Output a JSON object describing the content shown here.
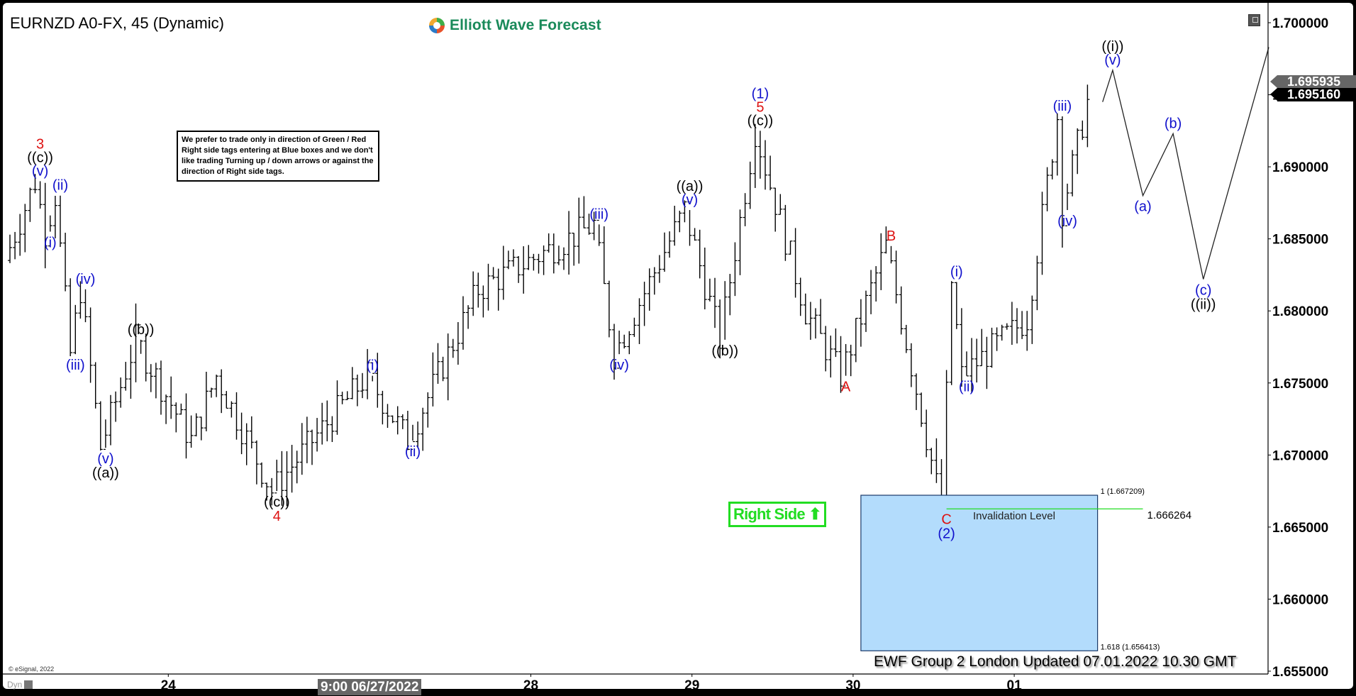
{
  "header": {
    "title": "EURNZD A0-FX, 45 (Dynamic)",
    "logo_text": "Elliott Wave Forecast",
    "notice": "We prefer to trade only in direction of Green / Red Right side tags entering at Blue boxes and we don't like trading Turning up / down arrows or against the direction of Right side tags."
  },
  "footer": {
    "copyright": "© eSignal, 2022",
    "dyn_label": "Dyn",
    "cursor_timestamp": "9:00 06/27/2022",
    "updated_text": "EWF Group 2 London Updated 07.01.2022 10.30 GMT"
  },
  "tags": {
    "right_side": "Right Side",
    "right_side_arrow": "up"
  },
  "price_tags": {
    "gray": "1.695935",
    "black": "1.695160"
  },
  "colors": {
    "bars": "#000000",
    "blue_labels": "#1010cc",
    "red_labels": "#dd1111",
    "black_labels": "#000000",
    "blue_box": "#b3dcfc",
    "invalidation_line": "#22dd22",
    "right_side": "#22dd22"
  },
  "chart_data": {
    "type": "ohlc",
    "symbol": "EURNZD A0-FX",
    "interval": "45 (Dynamic)",
    "ylim": [
      1.655,
      1.7
    ],
    "yticks": [
      "1.700000",
      "1.695000",
      "1.690000",
      "1.685000",
      "1.680000",
      "1.675000",
      "1.670000",
      "1.665000",
      "1.660000",
      "1.655000"
    ],
    "yticks_values": [
      1.7,
      1.695,
      1.69,
      1.685,
      1.68,
      1.675,
      1.67,
      1.665,
      1.66,
      1.655
    ],
    "xticks": [
      {
        "label": "24",
        "bar": 23
      },
      {
        "label": "28",
        "bar": 95
      },
      {
        "label": "29",
        "bar": 127
      },
      {
        "label": "30",
        "bar": 159
      },
      {
        "label": "01",
        "bar": 191
      }
    ],
    "last_price": 1.69516,
    "prev_close_tag": 1.695935,
    "path_anchors": [
      {
        "bar": 0,
        "price": 1.6835
      },
      {
        "bar": 6,
        "price": 1.689,
        "label": [
          "(v)",
          "((c))",
          "3"
        ]
      },
      {
        "bar": 8,
        "price": 1.6855,
        "label": [
          "(i)"
        ]
      },
      {
        "bar": 10,
        "price": 1.688,
        "label": [
          "(ii)"
        ]
      },
      {
        "bar": 13,
        "price": 1.677,
        "label": [
          "(iii)"
        ]
      },
      {
        "bar": 15,
        "price": 1.6815,
        "label": [
          "(iv)"
        ]
      },
      {
        "bar": 19,
        "price": 1.6705,
        "label": [
          "(v)",
          "((a))"
        ]
      },
      {
        "bar": 26,
        "price": 1.678,
        "label": [
          "((b))"
        ]
      },
      {
        "bar": 37,
        "price": 1.671
      },
      {
        "bar": 42,
        "price": 1.6755
      },
      {
        "bar": 53,
        "price": 1.6675,
        "label": [
          "((c))",
          "4"
        ]
      },
      {
        "bar": 61,
        "price": 1.671
      },
      {
        "bar": 72,
        "price": 1.6755,
        "label": [
          "(i)"
        ]
      },
      {
        "bar": 80,
        "price": 1.671,
        "label": [
          "(ii)"
        ]
      },
      {
        "bar": 94,
        "price": 1.6815
      },
      {
        "bar": 117,
        "price": 1.686,
        "label": [
          "(iii)"
        ]
      },
      {
        "bar": 121,
        "price": 1.677,
        "label": [
          "(iv)"
        ]
      },
      {
        "bar": 135,
        "price": 1.687,
        "label": [
          "(v)",
          "((a))"
        ]
      },
      {
        "bar": 142,
        "price": 1.678,
        "label": [
          "((b))"
        ]
      },
      {
        "bar": 149,
        "price": 1.6925,
        "label": [
          "((c))",
          "5",
          "(1)"
        ]
      },
      {
        "bar": 159,
        "price": 1.68
      },
      {
        "bar": 166,
        "price": 1.6755,
        "label": [
          "A"
        ]
      },
      {
        "bar": 175,
        "price": 1.6845,
        "label": [
          "B"
        ]
      },
      {
        "bar": 186,
        "price": 1.6663,
        "label": [
          "C",
          "(2)"
        ]
      },
      {
        "bar": 188,
        "price": 1.682,
        "label": [
          "(i)"
        ]
      },
      {
        "bar": 190,
        "price": 1.6755,
        "label": [
          "(ii)"
        ]
      },
      {
        "bar": 203,
        "price": 1.6795
      },
      {
        "bar": 209,
        "price": 1.6935,
        "label": [
          "(iii)"
        ]
      },
      {
        "bar": 210,
        "price": 1.687,
        "label": [
          "(iv)"
        ]
      },
      {
        "bar": 215,
        "price": 1.6945
      }
    ],
    "projection": [
      {
        "bar": 217,
        "price": 1.6945
      },
      {
        "bar": 219,
        "price": 1.6967,
        "label": [
          "(v)",
          "((i))"
        ]
      },
      {
        "bar": 225,
        "price": 1.688,
        "label": [
          "(a)"
        ]
      },
      {
        "bar": 231,
        "price": 1.6923,
        "label": [
          "(b)"
        ]
      },
      {
        "bar": 237,
        "price": 1.6822,
        "label": [
          "(c)",
          "((ii))"
        ]
      },
      {
        "bar": 250,
        "price": 1.6983
      }
    ],
    "blue_box": {
      "bar_start": 169,
      "bar_end": 216,
      "top": 1.667209,
      "bottom": 1.656413,
      "top_label": "1 (1.667209)",
      "bottom_label": "1.618 (1.656413)"
    },
    "invalidation": {
      "level": 1.666264,
      "label": "Invalidation Level",
      "value_label": "1.666264",
      "bar_start": 186,
      "bar_end": 225
    }
  }
}
